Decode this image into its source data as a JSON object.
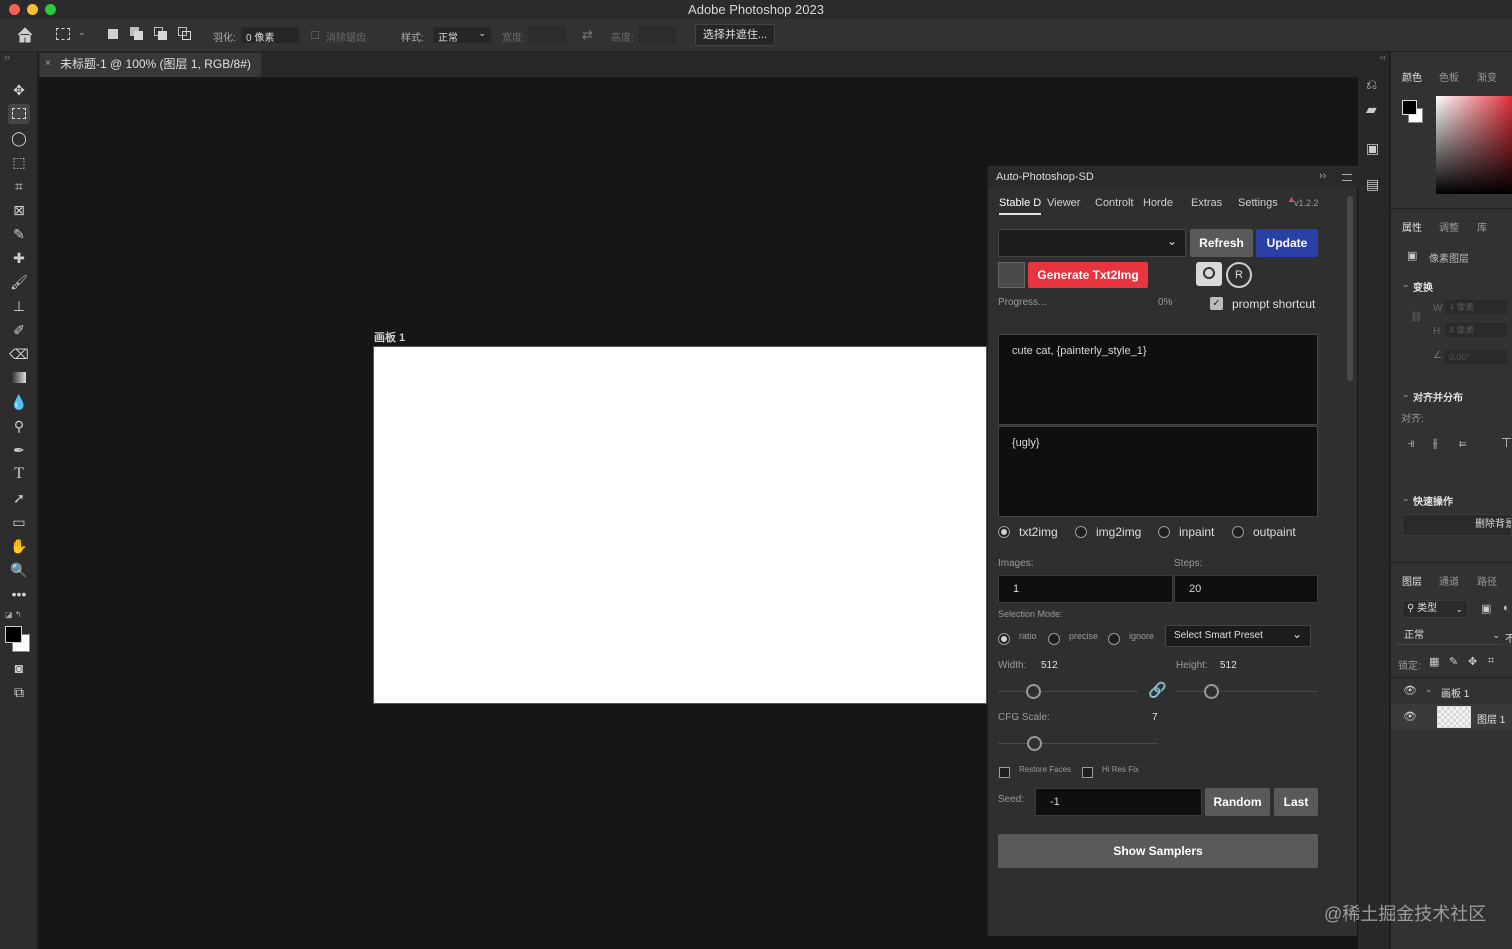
{
  "app": {
    "title": "Adobe Photoshop 2023"
  },
  "options_bar": {
    "feather_label": "羽化:",
    "feather_value": "0 像素",
    "antialias_label": "消除锯齿",
    "style_label": "样式:",
    "style_value": "正常",
    "width_label": "宽度:",
    "height_label": "高度:",
    "select_mask_button": "选择并遮住..."
  },
  "document": {
    "tab_title": "未标题-1 @ 100% (图层 1, RGB/8#)",
    "artboard_label": "画板 1"
  },
  "plugin": {
    "title": "Auto-Photoshop-SD",
    "tabs": [
      "Stable D",
      "Viewer",
      "Controlt",
      "Horde",
      "Extras",
      "Settings"
    ],
    "active_tab": "Stable D",
    "version": "v1.2.2",
    "refresh_label": "Refresh",
    "update_label": "Update",
    "generate_label": "Generate Txt2Img",
    "camera_icon": "camera-icon",
    "r_icon_text": "R",
    "progress_label": "Progress...",
    "progress_value": "0%",
    "progress_fraction": 0,
    "prompt_shortcut_label": "prompt shortcut",
    "prompt_shortcut_checked": true,
    "prompt": "cute cat, {painterly_style_1}",
    "negative_prompt": "{ugly}",
    "modes": [
      "txt2img",
      "img2img",
      "inpaint",
      "outpaint"
    ],
    "selected_mode": "txt2img",
    "images_label": "Images:",
    "images_value": "1",
    "steps_label": "Steps:",
    "steps_value": "20",
    "selection_mode_label": "Selection Mode:",
    "selection_modes": [
      "ratio",
      "precise",
      "ignore"
    ],
    "selected_selection_mode": "ratio",
    "smart_preset_placeholder": "Select Smart Preset",
    "width_label": "Width:",
    "width_value": "512",
    "height_label": "Height:",
    "height_value": "512",
    "cfg_label": "CFG Scale:",
    "cfg_value": "7",
    "restore_faces_label": "Restore Faces",
    "hires_fix_label": "Hi Res Fix",
    "seed_label": "Seed:",
    "seed_value": "-1",
    "random_label": "Random",
    "last_label": "Last",
    "show_samplers_label": "Show Samplers",
    "colors": {
      "generate": "#e8343f",
      "update": "#2a3fa8",
      "refresh": "#5a5a5a"
    }
  },
  "right_panel": {
    "color_tabs": [
      "颜色",
      "色板",
      "渐变"
    ],
    "props_tabs": [
      "属性",
      "调整",
      "库"
    ],
    "pixel_layer_label": "像素图层",
    "transform_label": "变换",
    "w_label": "W",
    "w_value": "4 像素",
    "h_label": "H",
    "h_value": "4 像素",
    "angle_value": "0.00°",
    "align_label": "对齐并分布",
    "align_sub": "对齐:",
    "quick_actions_label": "快速操作",
    "remove_bg_label": "删除背景",
    "layer_tabs": [
      "图层",
      "通道",
      "路径"
    ],
    "kind_filter": "类型",
    "blend_mode": "正常",
    "opacity_label": "不",
    "lock_label": "锁定:",
    "layers": [
      {
        "name": "画板 1",
        "type": "group"
      },
      {
        "name": "图层 1",
        "type": "layer"
      }
    ]
  },
  "watermark": "@稀土掘金技术社区"
}
